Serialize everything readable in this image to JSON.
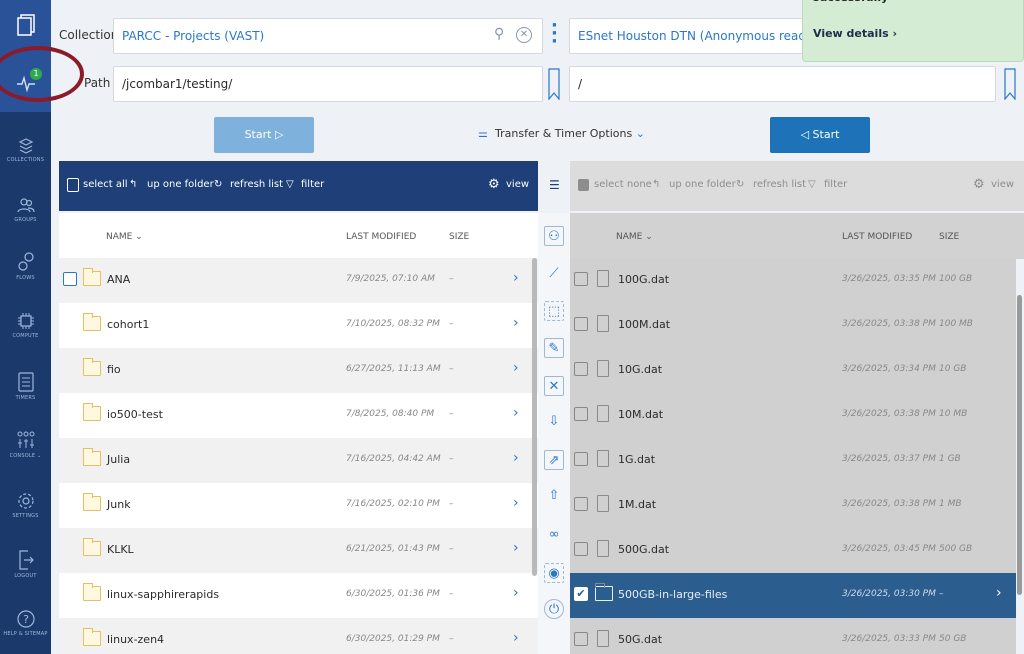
{
  "sidebar": {
    "items": [
      {
        "label": "COLLECTIONS",
        "icon": "collections-icon"
      },
      {
        "label": "GROUPS",
        "icon": "groups-icon"
      },
      {
        "label": "FLOWS",
        "icon": "flows-icon"
      },
      {
        "label": "COMPUTE",
        "icon": "compute-icon"
      },
      {
        "label": "TIMERS",
        "icon": "timers-icon"
      },
      {
        "label": "CONSOLE ⌄",
        "icon": "console-icon"
      },
      {
        "label": "SETTINGS",
        "icon": "settings-icon"
      },
      {
        "label": "LOGOUT",
        "icon": "logout-icon"
      },
      {
        "label": "HELP & SITEMAP",
        "icon": "help-icon"
      }
    ],
    "activity_badge": "1"
  },
  "header": {
    "collection_label": "Collection",
    "path_label": "Path",
    "left_collection": "PARCC - Projects (VAST)",
    "left_path": "/jcombar1/testing/",
    "right_collection": "ESnet Houston DTN (Anonymous read-only testing)",
    "right_path": "/"
  },
  "toast": {
    "title": "successfully",
    "link": "View details  ›"
  },
  "options": {
    "start_left": "Start",
    "start_right": "Start",
    "transfer_options": "Transfer & Timer Options"
  },
  "left_toolbar": {
    "select_all": "select all",
    "up_folder": "up one folder",
    "refresh": "refresh list",
    "filter": "filter",
    "view": "view"
  },
  "right_toolbar": {
    "select_none": "select none",
    "up_folder": "up one folder",
    "refresh": "refresh list",
    "filter": "filter",
    "view": "view"
  },
  "columns": {
    "name": "NAME ⌄",
    "modified": "LAST MODIFIED",
    "size": "SIZE"
  },
  "left_rows": [
    {
      "name": "ANA",
      "modified": "7/9/2025, 07:10 AM",
      "size": "–"
    },
    {
      "name": "cohort1",
      "modified": "7/10/2025, 08:32 PM",
      "size": "–"
    },
    {
      "name": "fio",
      "modified": "6/27/2025, 11:13 AM",
      "size": "–"
    },
    {
      "name": "io500-test",
      "modified": "7/8/2025, 08:40 PM",
      "size": "–"
    },
    {
      "name": "Julia",
      "modified": "7/16/2025, 04:42 AM",
      "size": "–"
    },
    {
      "name": "Junk",
      "modified": "7/16/2025, 02:10 PM",
      "size": "–"
    },
    {
      "name": "KLKL",
      "modified": "6/21/2025, 01:43 PM",
      "size": "–"
    },
    {
      "name": "linux-sapphirerapids",
      "modified": "6/30/2025, 01:36 PM",
      "size": "–"
    },
    {
      "name": "linux-zen4",
      "modified": "6/30/2025, 01:29 PM",
      "size": "–"
    }
  ],
  "right_rows": [
    {
      "name": "100G.dat",
      "modified": "3/26/2025, 03:35 PM",
      "size": "100 GB"
    },
    {
      "name": "100M.dat",
      "modified": "3/26/2025, 03:38 PM",
      "size": "100 MB"
    },
    {
      "name": "10G.dat",
      "modified": "3/26/2025, 03:34 PM",
      "size": "10 GB"
    },
    {
      "name": "10M.dat",
      "modified": "3/26/2025, 03:38 PM",
      "size": "10 MB"
    },
    {
      "name": "1G.dat",
      "modified": "3/26/2025, 03:37 PM",
      "size": "1 GB"
    },
    {
      "name": "1M.dat",
      "modified": "3/26/2025, 03:38 PM",
      "size": "1 MB"
    },
    {
      "name": "500G.dat",
      "modified": "3/26/2025, 03:45 PM",
      "size": "500 GB"
    },
    {
      "name": "500GB-in-large-files",
      "modified": "3/26/2025, 03:30 PM",
      "size": "–"
    },
    {
      "name": "50G.dat",
      "modified": "3/26/2025, 03:33 PM",
      "size": "50 GB"
    }
  ],
  "colors": {
    "sidebar": "#1b3a6b",
    "accent": "#2a77c9",
    "selected_row": "#2b5d8f",
    "toast": "#d4ecd4"
  }
}
